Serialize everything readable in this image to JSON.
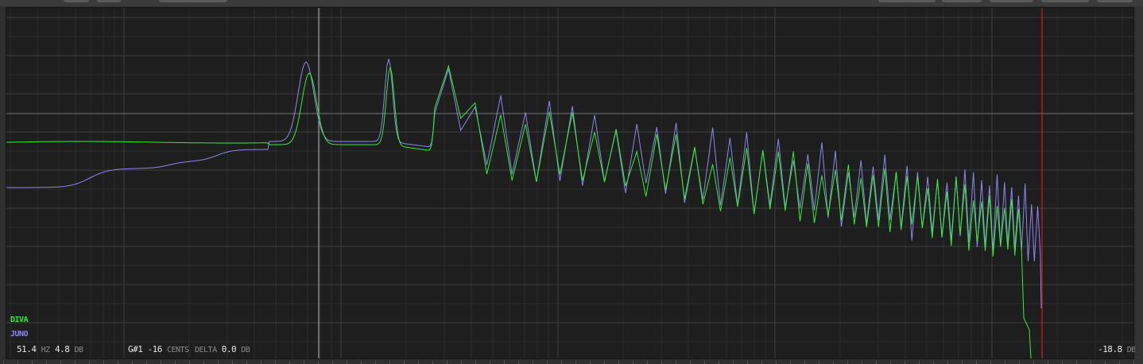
{
  "colors": {
    "background": "#1e1e1e",
    "grid_major": "#3d3d3d",
    "grid_minor": "#2c2c2c",
    "diva": "#33ee33",
    "juno": "#8c86f0",
    "cursor": "#bdbdbd",
    "limit_marker": "#d11f1f"
  },
  "legend": {
    "diva": "DIVA",
    "juno": "JUNO"
  },
  "readout": {
    "freq_value": "51.4",
    "freq_unit": "HZ",
    "gain_value": "4.8",
    "gain_unit": "DB",
    "note_value": "G#1",
    "cents_value": "-16",
    "cents_unit": "CENTS",
    "delta_label": "DELTA",
    "delta_value": "0.0",
    "delta_unit": "DB",
    "level_value": "-18.8",
    "level_unit": "DB"
  }
}
